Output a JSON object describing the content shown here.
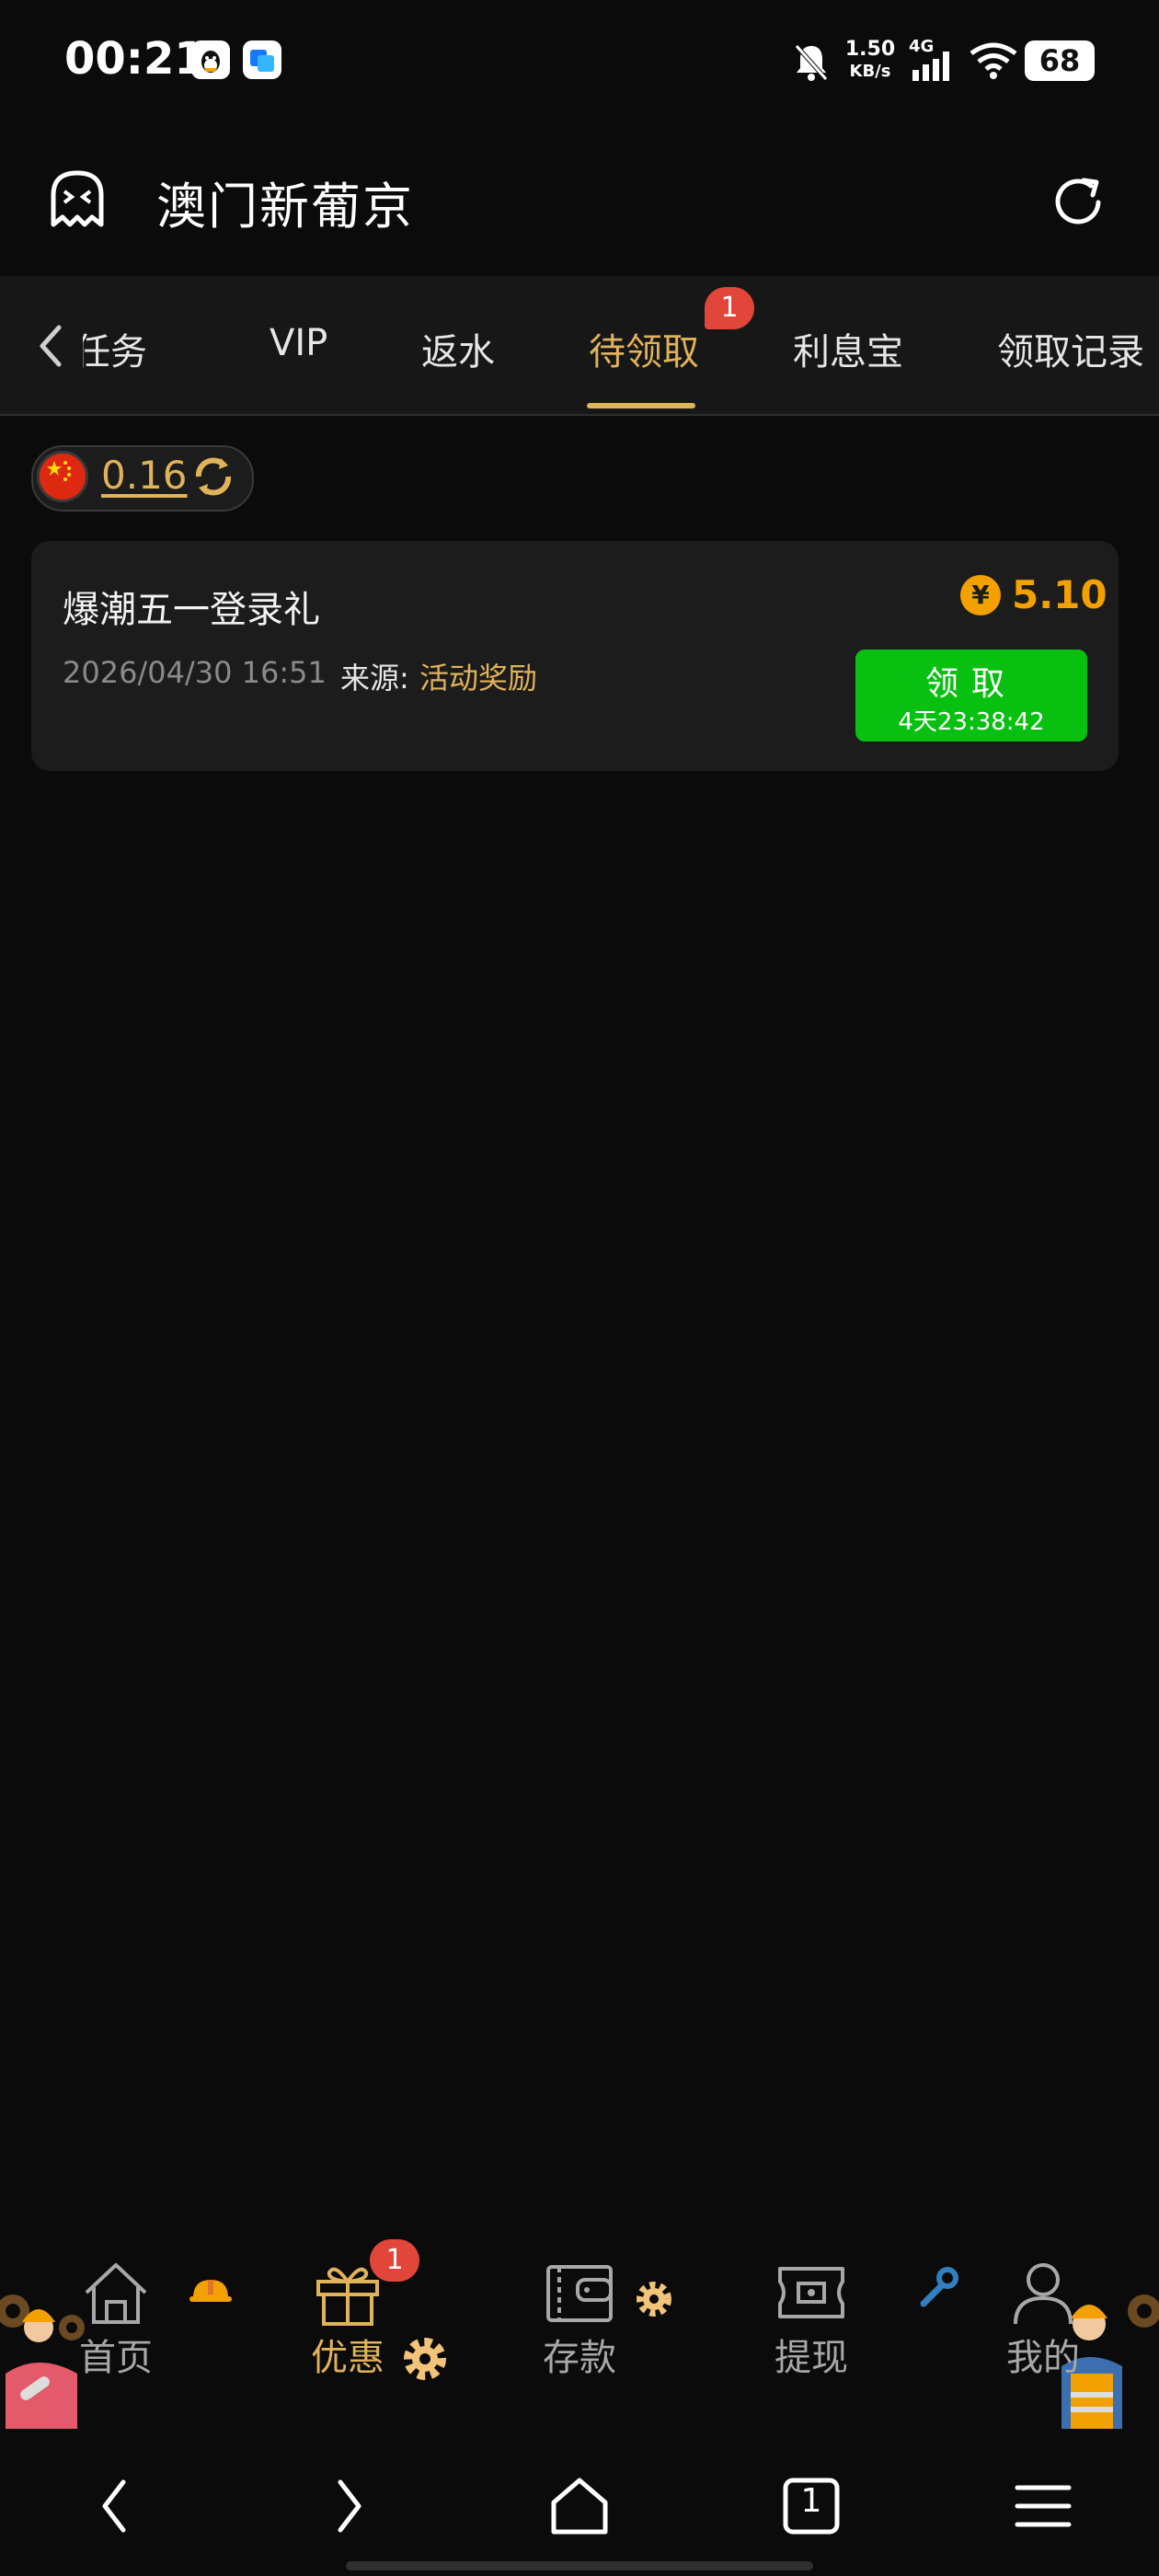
{
  "status_bar": {
    "time": "00:21",
    "net_speed_value": "1.50",
    "net_speed_unit": "KB/s",
    "network_type": "4G",
    "battery": "68"
  },
  "header": {
    "title": "澳门新葡京",
    "app_icon": "ghost-icon",
    "refresh_icon": "refresh-icon"
  },
  "tabs": {
    "items": [
      {
        "label": "任务"
      },
      {
        "label": "VIP"
      },
      {
        "label": "返水"
      },
      {
        "label": "待领取"
      },
      {
        "label": "利息宝"
      },
      {
        "label": "领取记录"
      }
    ],
    "active_index": 3,
    "active_badge": "1"
  },
  "balance": {
    "value": "0.16",
    "flag": "china-flag-icon",
    "refresh": "sync-icon"
  },
  "rewards": [
    {
      "title": "爆潮五一登录礼",
      "date": "2026/04/30 16:51",
      "source_label": "来源:",
      "source_value": "活动奖励",
      "currency_symbol": "¥",
      "amount": "5.10",
      "button_label": "领取",
      "countdown": "4天23:38:42"
    }
  ],
  "bottom_nav": {
    "items": [
      {
        "label": "首页",
        "icon": "home-icon"
      },
      {
        "label": "优惠",
        "icon": "gift-icon"
      },
      {
        "label": "存款",
        "icon": "wallet-icon"
      },
      {
        "label": "提现",
        "icon": "cash-icon"
      },
      {
        "label": "我的",
        "icon": "user-icon"
      }
    ],
    "active_index": 1,
    "promo_badge": "1"
  },
  "system_nav": {
    "tab_count": "1"
  },
  "colors": {
    "background": "#0b0b0b",
    "accent_gold": "#e0b35a",
    "amount_orange": "#f2a100",
    "claim_green": "#08c010",
    "badge_red": "#e2453a"
  }
}
